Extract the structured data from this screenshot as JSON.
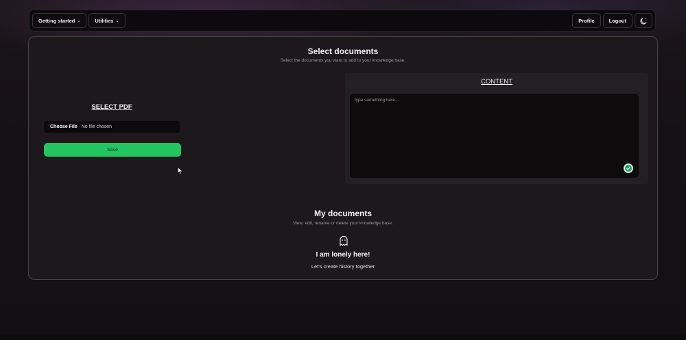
{
  "nav": {
    "getting_started_label": "Getting started",
    "utilities_label": "Utilities",
    "profile_label": "Profile",
    "logout_label": "Logout",
    "theme_icon": "moon-icon"
  },
  "select_section": {
    "title": "Select documents",
    "subtitle": "Select the documents you want to add to your knowledge base.",
    "pdf_label": "SELECT PDF",
    "choose_file_label": "Choose File",
    "file_status": "No file chosen",
    "save_label": "Save",
    "save_color": "#22c55e"
  },
  "content_panel": {
    "label": "CONTENT",
    "placeholder": "type something here..."
  },
  "my_documents": {
    "title": "My documents",
    "subtitle": "View, edit, rename or delete your knowledge base.",
    "empty_icon": "ghost-icon",
    "empty_title": "I am lonely here!",
    "empty_subtitle": "Let's create history together"
  }
}
